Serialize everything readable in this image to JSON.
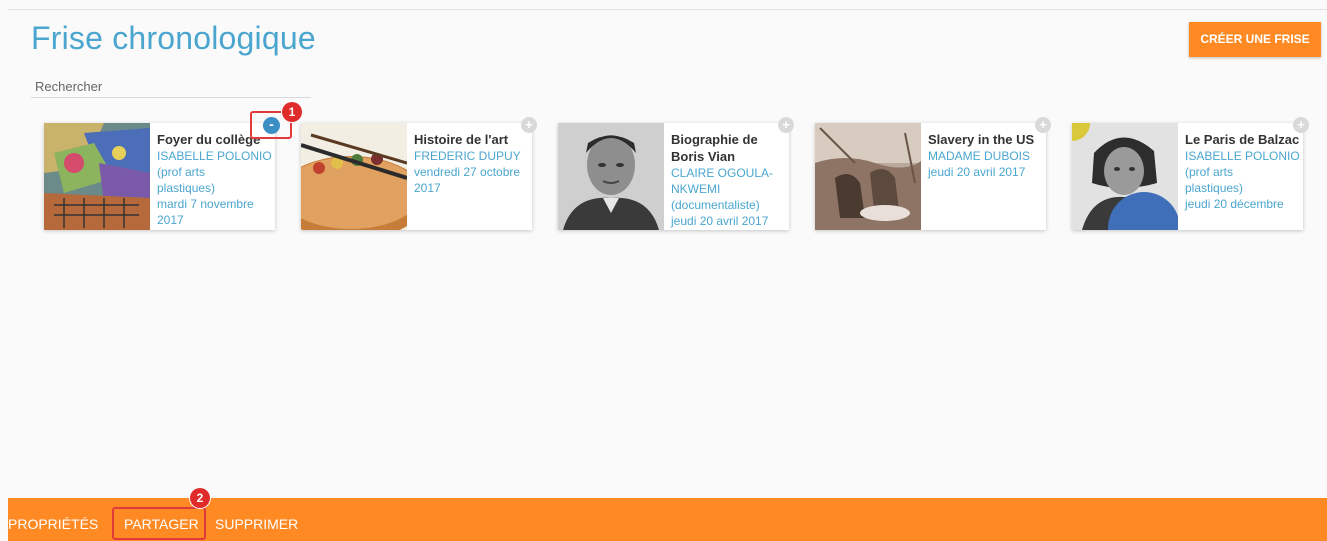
{
  "header": {
    "title": "Frise chronologique",
    "create_label": "CRÉER UNE FRISE"
  },
  "search": {
    "placeholder": "Rechercher"
  },
  "cards": [
    {
      "title": "Foyer du collège",
      "lines": [
        "ISABELLE POLONIO",
        "(prof arts",
        "plastiques)",
        "mardi 7 novembre",
        "2017"
      ],
      "selected": true,
      "toggle": "-"
    },
    {
      "title": "Histoire de l'art",
      "lines": [
        "FREDERIC DUPUY",
        "vendredi 27 octobre",
        "2017"
      ],
      "selected": false,
      "toggle": "+"
    },
    {
      "title": "Biographie de Boris Vian",
      "lines": [
        "CLAIRE OGOULA-",
        "NKWEMI",
        "(documentaliste)",
        "jeudi 20 avril 2017"
      ],
      "selected": false,
      "toggle": "+"
    },
    {
      "title": "Slavery in the US",
      "lines": [
        "MADAME DUBOIS",
        "jeudi 20 avril 2017"
      ],
      "selected": false,
      "toggle": "+"
    },
    {
      "title": "Le Paris de Balzac",
      "lines": [
        "ISABELLE POLONIO",
        "(prof arts",
        "plastiques)",
        "jeudi 20 décembre"
      ],
      "selected": false,
      "toggle": "+"
    }
  ],
  "annotations": {
    "badge1": "1",
    "badge2": "2"
  },
  "bottom_bar": {
    "properties_label": "PROPRIÉTÉS",
    "share_label": "PARTAGER",
    "delete_label": "SUPPRIMER"
  },
  "colors": {
    "accent": "#ff8a24",
    "title_blue": "#4aa6cf",
    "selected_toggle": "#3b8fc4",
    "annotation_red": "#e02b2b"
  }
}
